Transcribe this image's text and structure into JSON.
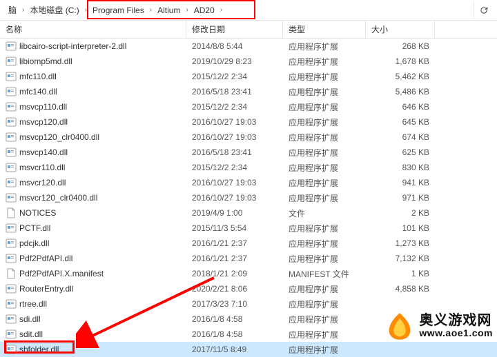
{
  "breadcrumb": {
    "items": [
      {
        "label": "脑"
      },
      {
        "label": "本地磁盘 (C:)"
      },
      {
        "label": "Program Files"
      },
      {
        "label": "Altium"
      },
      {
        "label": "AD20"
      }
    ]
  },
  "columns": {
    "name": "名称",
    "date": "修改日期",
    "type": "类型",
    "size": "大小"
  },
  "files": [
    {
      "name": "libcairo-script-interpreter-2.dll",
      "date": "2014/8/8 5:44",
      "type": "应用程序扩展",
      "size": "268 KB",
      "icon": "dll"
    },
    {
      "name": "libiomp5md.dll",
      "date": "2019/10/29 8:23",
      "type": "应用程序扩展",
      "size": "1,678 KB",
      "icon": "dll"
    },
    {
      "name": "mfc110.dll",
      "date": "2015/12/2 2:34",
      "type": "应用程序扩展",
      "size": "5,462 KB",
      "icon": "dll"
    },
    {
      "name": "mfc140.dll",
      "date": "2016/5/18 23:41",
      "type": "应用程序扩展",
      "size": "5,486 KB",
      "icon": "dll"
    },
    {
      "name": "msvcp110.dll",
      "date": "2015/12/2 2:34",
      "type": "应用程序扩展",
      "size": "646 KB",
      "icon": "dll"
    },
    {
      "name": "msvcp120.dll",
      "date": "2016/10/27 19:03",
      "type": "应用程序扩展",
      "size": "645 KB",
      "icon": "dll"
    },
    {
      "name": "msvcp120_clr0400.dll",
      "date": "2016/10/27 19:03",
      "type": "应用程序扩展",
      "size": "674 KB",
      "icon": "dll"
    },
    {
      "name": "msvcp140.dll",
      "date": "2016/5/18 23:41",
      "type": "应用程序扩展",
      "size": "625 KB",
      "icon": "dll"
    },
    {
      "name": "msvcr110.dll",
      "date": "2015/12/2 2:34",
      "type": "应用程序扩展",
      "size": "830 KB",
      "icon": "dll"
    },
    {
      "name": "msvcr120.dll",
      "date": "2016/10/27 19:03",
      "type": "应用程序扩展",
      "size": "941 KB",
      "icon": "dll"
    },
    {
      "name": "msvcr120_clr0400.dll",
      "date": "2016/10/27 19:03",
      "type": "应用程序扩展",
      "size": "971 KB",
      "icon": "dll"
    },
    {
      "name": "NOTICES",
      "date": "2019/4/9 1:00",
      "type": "文件",
      "size": "2 KB",
      "icon": "file"
    },
    {
      "name": "PCTF.dll",
      "date": "2015/11/3 5:54",
      "type": "应用程序扩展",
      "size": "101 KB",
      "icon": "dll"
    },
    {
      "name": "pdcjk.dll",
      "date": "2016/1/21 2:37",
      "type": "应用程序扩展",
      "size": "1,273 KB",
      "icon": "dll"
    },
    {
      "name": "Pdf2PdfAPI.dll",
      "date": "2016/1/21 2:37",
      "type": "应用程序扩展",
      "size": "7,132 KB",
      "icon": "dll"
    },
    {
      "name": "Pdf2PdfAPI.X.manifest",
      "date": "2018/1/21 2:09",
      "type": "MANIFEST 文件",
      "size": "1 KB",
      "icon": "file"
    },
    {
      "name": "RouterEntry.dll",
      "date": "2020/2/21 8:06",
      "type": "应用程序扩展",
      "size": "4,858 KB",
      "icon": "dll"
    },
    {
      "name": "rtree.dll",
      "date": "2017/3/23 7:10",
      "type": "应用程序扩展",
      "size": "",
      "icon": "dll"
    },
    {
      "name": "sdi.dll",
      "date": "2016/1/8 4:58",
      "type": "应用程序扩展",
      "size": "",
      "icon": "dll"
    },
    {
      "name": "sdit.dll",
      "date": "2016/1/8 4:58",
      "type": "应用程序扩展",
      "size": "",
      "icon": "dll"
    },
    {
      "name": "shfolder.dll",
      "date": "2017/11/5 8:49",
      "type": "应用程序扩展",
      "size": "",
      "icon": "dll",
      "selected": true
    }
  ],
  "watermark": {
    "title": "奥义游戏网",
    "url": "www.aoe1.com"
  }
}
